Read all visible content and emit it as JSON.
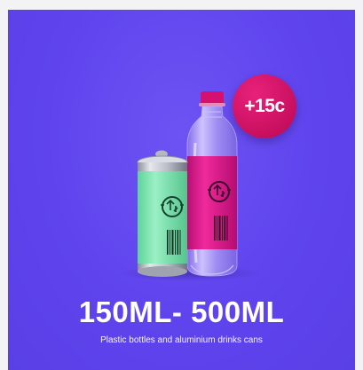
{
  "promo": {
    "badge_text": "+15c",
    "headline": "150ML- 500ML",
    "subtext": "Plastic bottles and aluminium drinks cans"
  },
  "colors": {
    "background": "#5f44ee",
    "badge": "#c80f5f",
    "can_label": "#7fe6b0",
    "bottle_label": "#e0148a",
    "bottle_cap": "#d6106e"
  },
  "icons": [
    "recycle-logo-icon",
    "barcode-icon"
  ]
}
